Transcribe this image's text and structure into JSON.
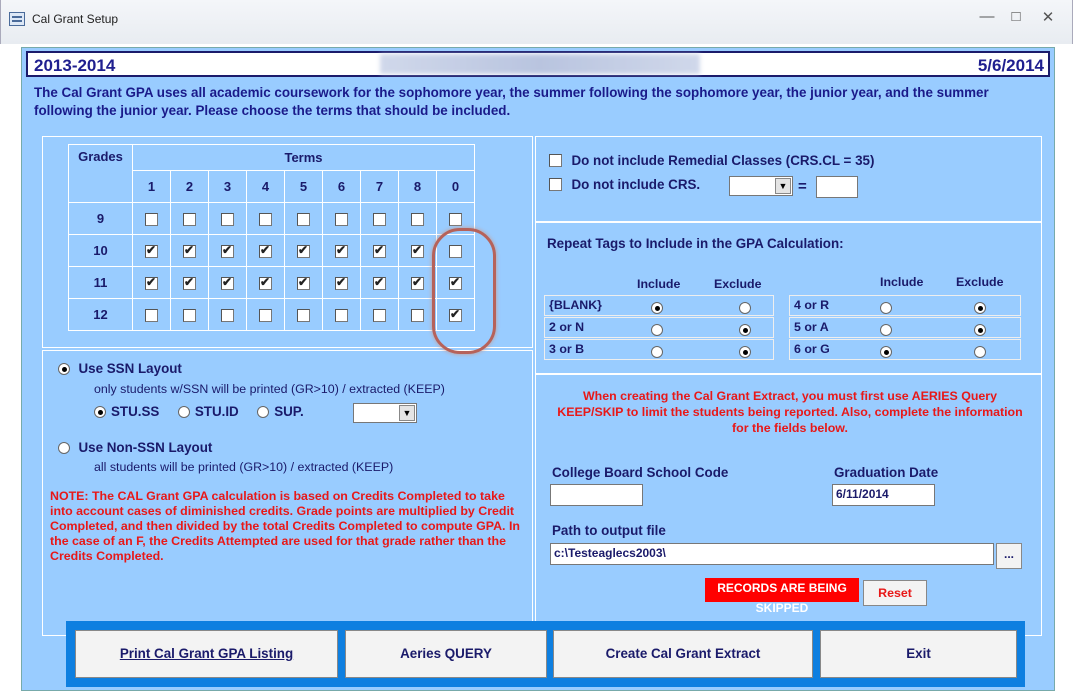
{
  "window": {
    "title": "Cal Grant Setup",
    "min": "—",
    "max": "□",
    "close": "✕"
  },
  "header": {
    "year": "2013-2014",
    "date": "5/6/2014"
  },
  "intro": "The Cal Grant GPA uses all academic coursework for the sophomore year, the summer following the sophomore year, the junior year, and the summer following the junior year. Please choose the terms that should be included.",
  "grid": {
    "grades_label": "Grades",
    "terms_label": "Terms",
    "terms": [
      "1",
      "2",
      "3",
      "4",
      "5",
      "6",
      "7",
      "8",
      "0"
    ],
    "rows": [
      {
        "grade": "9",
        "checks": [
          false,
          false,
          false,
          false,
          false,
          false,
          false,
          false,
          false
        ]
      },
      {
        "grade": "10",
        "checks": [
          true,
          true,
          true,
          true,
          true,
          true,
          true,
          true,
          false
        ]
      },
      {
        "grade": "11",
        "checks": [
          true,
          true,
          true,
          true,
          true,
          true,
          true,
          true,
          true
        ]
      },
      {
        "grade": "12",
        "checks": [
          false,
          false,
          false,
          false,
          false,
          false,
          false,
          false,
          true
        ]
      }
    ]
  },
  "layout": {
    "ssn_label": "Use SSN Layout",
    "ssn_desc": "only students w/SSN will be printed (GR>10) / extracted (KEEP)",
    "opt_ss": "STU.SS",
    "opt_id": "STU.ID",
    "opt_sup": "SUP.",
    "nonssn_label": "Use Non-SSN Layout",
    "nonssn_desc": "all students will be printed (GR>10) / extracted (KEEP)"
  },
  "note": "NOTE: The CAL Grant GPA calculation is based on Credits Completed to take into account cases of diminished credits. Grade points are multiplied by Credit Completed, and then divided by the total Credits Completed to compute GPA. In the case of an F, the Credits Attempted are used for that grade rather than the Credits Completed.",
  "filters": {
    "remedial": "Do not include Remedial Classes (CRS.CL = 35)",
    "crs": "Do not include CRS.",
    "eq": "="
  },
  "repeat": {
    "title": "Repeat Tags to Include in the GPA Calculation:",
    "include": "Include",
    "exclude": "Exclude",
    "left": [
      {
        "tag": "{BLANK}",
        "include": true
      },
      {
        "tag": "2 or N",
        "include": false
      },
      {
        "tag": "3 or B",
        "include": false
      }
    ],
    "right": [
      {
        "tag": "4 or R",
        "include": false
      },
      {
        "tag": "5 or A",
        "include": false
      },
      {
        "tag": "6 or G",
        "include": true
      }
    ]
  },
  "extract": {
    "message": "When creating the Cal Grant Extract, you must first use AERIES Query KEEP/SKIP to limit the students being reported. Also, complete the information for the fields below.",
    "cb_code_label": "College Board School Code",
    "cb_code": "",
    "grad_label": "Graduation Date",
    "grad_date": "6/11/2014",
    "path_label": "Path to output file",
    "path": "c:\\Testeaglecs2003\\",
    "browse": "...",
    "skip_badge": "RECORDS ARE BEING SKIPPED",
    "reset": "Reset"
  },
  "buttons": {
    "print": "Print Cal Grant GPA Listing",
    "query": "Aeries QUERY",
    "create": "Create Cal Grant Extract",
    "exit": "Exit"
  },
  "colors": {
    "panel": "#99ccff",
    "label": "#1a1a6a",
    "warning": "#e81818",
    "button_bar": "#0e7fe0"
  }
}
